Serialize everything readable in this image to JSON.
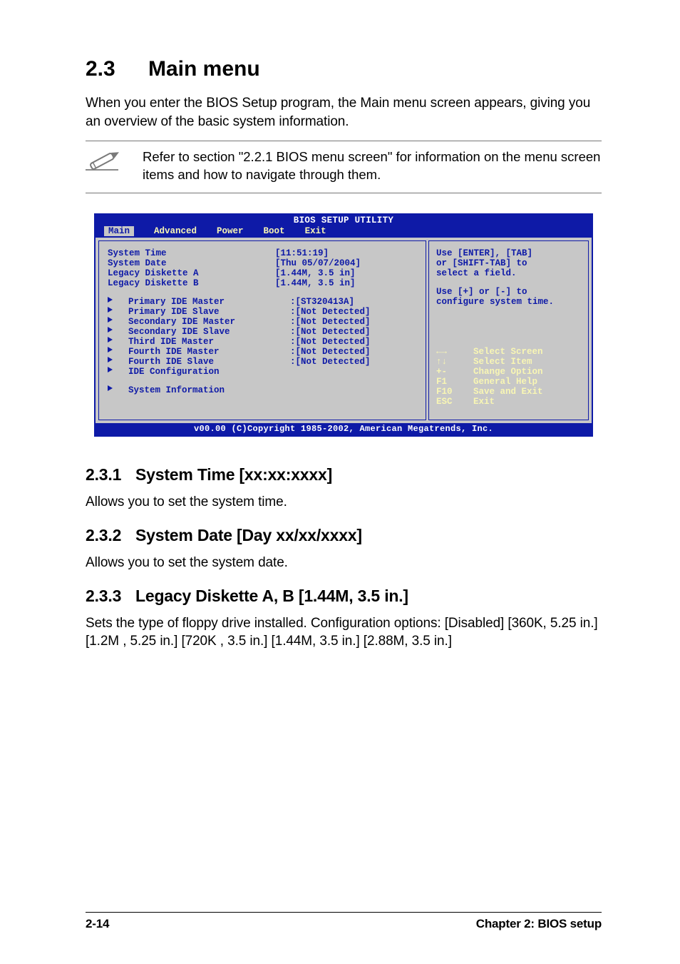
{
  "heading": {
    "num": "2.3",
    "title": "Main menu"
  },
  "intro": "When you enter the BIOS Setup program, the Main menu screen appears, giving you an overview of the basic system information.",
  "note": "Refer to section \"2.2.1  BIOS menu screen\" for information on the menu screen items and how to navigate through them.",
  "bios": {
    "title": "BIOS SETUP UTILITY",
    "tabs": [
      "Main",
      "Advanced",
      "Power",
      "Boot",
      "Exit"
    ],
    "rows_top": [
      {
        "label": "System Time",
        "value": "[11:51:19]"
      },
      {
        "label": "System Date",
        "value": "[Thu 05/07/2004]"
      },
      {
        "label": "Legacy Diskette A",
        "value": "[1.44M, 3.5 in]"
      },
      {
        "label": "Legacy Diskette B",
        "value": "[1.44M, 3.5 in]"
      }
    ],
    "rows_sub": [
      {
        "label": "Primary IDE Master",
        "value": ":[ST320413A]"
      },
      {
        "label": "Primary IDE Slave",
        "value": ":[Not Detected]"
      },
      {
        "label": "Secondary IDE Master",
        "value": ":[Not Detected]"
      },
      {
        "label": "Secondary IDE Slave",
        "value": ":[Not Detected]"
      },
      {
        "label": "Third IDE Master",
        "value": ":[Not Detected]"
      },
      {
        "label": "Fourth IDE Master",
        "value": ":[Not Detected]"
      },
      {
        "label": "Fourth IDE Slave",
        "value": ":[Not Detected]"
      },
      {
        "label": "IDE Configuration",
        "value": ""
      }
    ],
    "rows_last": [
      {
        "label": "System Information",
        "value": ""
      }
    ],
    "help_text": [
      "Use [ENTER], [TAB]",
      "or [SHIFT-TAB] to",
      "select a field.",
      "",
      "Use [+] or [-] to",
      "configure system time."
    ],
    "help_keys": [
      {
        "k": "←→",
        "d": "Select Screen"
      },
      {
        "k": "↑↓",
        "d": "Select Item"
      },
      {
        "k": "+-",
        "d": "Change Option"
      },
      {
        "k": "F1",
        "d": "General Help"
      },
      {
        "k": "F10",
        "d": "Save and Exit"
      },
      {
        "k": "ESC",
        "d": "Exit"
      }
    ],
    "footer": "v00.00 (C)Copyright 1985-2002, American Megatrends, Inc."
  },
  "sections": [
    {
      "num": "2.3.1",
      "title": "System Time [xx:xx:xxxx]",
      "body": "Allows you to set the system time."
    },
    {
      "num": "2.3.2",
      "title": "System Date [Day xx/xx/xxxx]",
      "body": "Allows you to set the system date."
    },
    {
      "num": "2.3.3",
      "title": "Legacy Diskette A, B [1.44M, 3.5 in.]",
      "body": "Sets the type of floppy drive installed. Configuration options: [Disabled] [360K, 5.25 in.] [1.2M , 5.25 in.] [720K , 3.5 in.] [1.44M, 3.5 in.] [2.88M, 3.5 in.]"
    }
  ],
  "page_footer": {
    "left": "2-14",
    "right": "Chapter 2: BIOS setup"
  }
}
